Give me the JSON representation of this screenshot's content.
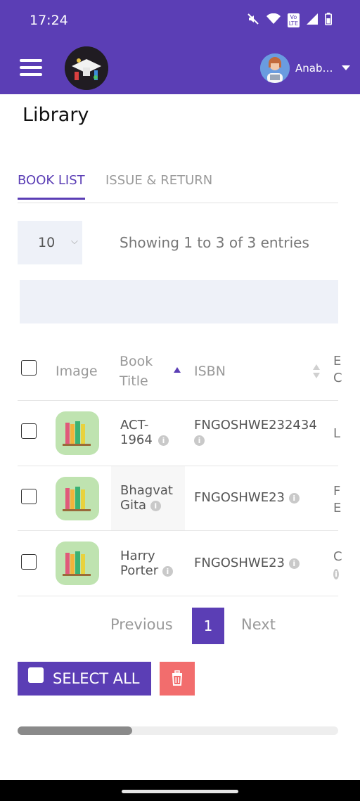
{
  "status_bar": {
    "time": "17:24",
    "icons": [
      "mute-icon",
      "wifi-icon",
      "volte-icon",
      "signal-icon",
      "battery-icon"
    ],
    "lte_text": "Vo\nLTE"
  },
  "app_bar": {
    "color": "#5b3eb5",
    "user_name": "Anabelle"
  },
  "page": {
    "title": "Library"
  },
  "tabs": [
    {
      "label": "BOOK LIST",
      "active": true
    },
    {
      "label": "ISSUE & RETURN",
      "active": false
    }
  ],
  "table_controls": {
    "page_size": "10",
    "entries_info": "Showing 1 to 3 of 3 entries"
  },
  "table": {
    "headers": {
      "image": "Image",
      "title": "Book Title",
      "isbn": "ISBN"
    },
    "rows": [
      {
        "title": "ACT-1964",
        "isbn": "FNGOSHWE232434",
        "extra": "L"
      },
      {
        "title": "Bhagvat Gita",
        "isbn": "FNGOSHWE23",
        "extra": "F"
      },
      {
        "title": "Harry Porter",
        "isbn": "FNGOSHWE23",
        "extra": "C"
      }
    ]
  },
  "pagination": {
    "previous": "Previous",
    "current": "1",
    "next": "Next"
  },
  "actions": {
    "select_all": "SELECT ALL",
    "delete_color": "#f26d6d"
  },
  "colors": {
    "accent": "#5b3eb5",
    "tab_inactive": "#9a9a9a",
    "thumb_bg": "#bfe3b0"
  }
}
